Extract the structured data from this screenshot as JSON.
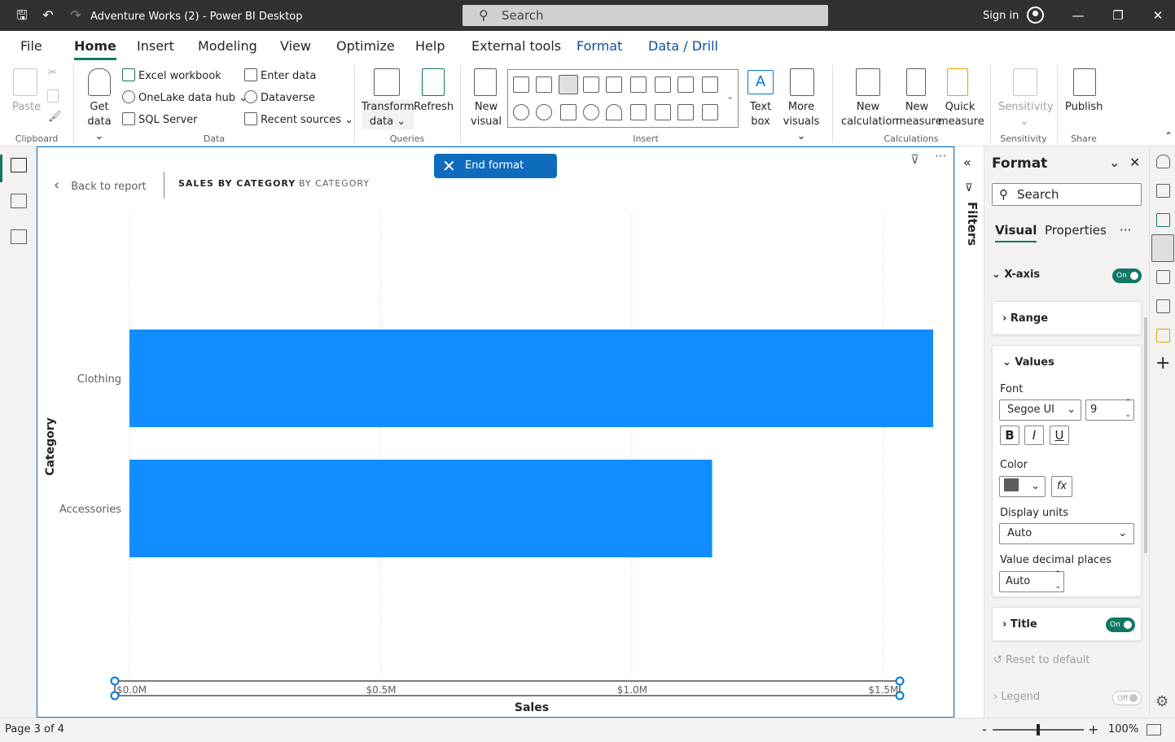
{
  "window": {
    "title": "Adventure Works (2) - Power BI Desktop",
    "search_placeholder": "Search",
    "sign_in": "Sign in"
  },
  "menu_tabs": [
    "File",
    "Home",
    "Insert",
    "Modeling",
    "View",
    "Optimize",
    "Help",
    "External tools",
    "Format",
    "Data / Drill"
  ],
  "ribbon": {
    "clipboard": {
      "paste": "Paste",
      "group": "Clipboard"
    },
    "data": {
      "get_data": "Get",
      "get_data2": "data",
      "excel": "Excel workbook",
      "onelake": "OneLake data hub",
      "sql": "SQL Server",
      "enter_data": "Enter data",
      "dataverse": "Dataverse",
      "recent": "Recent sources",
      "group": "Data"
    },
    "queries": {
      "transform": "Transform",
      "transform2": "data",
      "refresh": "Refresh",
      "group": "Queries"
    },
    "insert": {
      "new_visual": "New",
      "new_visual2": "visual",
      "text_box": "Text",
      "text_box2": "box",
      "more_visuals": "More",
      "more_visuals2": "visuals",
      "group": "Insert"
    },
    "calculations": {
      "new_calc": "New",
      "new_calc2": "calculation",
      "new_measure": "New",
      "new_measure2": "measure",
      "quick": "Quick",
      "quick2": "measure",
      "group": "Calculations"
    },
    "sensitivity": {
      "label": "Sensitivity",
      "group": "Sensitivity"
    },
    "share": {
      "publish": "Publish",
      "group": "Share"
    }
  },
  "canvas": {
    "back": "Back to report",
    "crumb1": "SALES BY CATEGORY",
    "crumb2": "BY CATEGORY",
    "end_format": "End format mode"
  },
  "chart_data": {
    "type": "bar",
    "orientation": "horizontal",
    "categories": [
      "Clothing",
      "Accessories"
    ],
    "values": [
      1.6,
      1.16
    ],
    "xlabel": "Sales",
    "ylabel": "Category",
    "xlim": [
      0,
      1.6
    ],
    "x_ticks": [
      "$0.0M",
      "$0.5M",
      "$1.0M",
      "$1.5M"
    ],
    "x_tick_values": [
      0,
      0.5,
      1.0,
      1.5
    ],
    "bar_color": "#118dff",
    "grid": true
  },
  "filters_pane": {
    "label": "Filters"
  },
  "format_pane": {
    "title": "Format",
    "search_placeholder": "Search",
    "tabs": [
      "Visual",
      "Properties"
    ],
    "xaxis": "X-axis",
    "on": "On",
    "off": "Off",
    "range": "Range",
    "values": "Values",
    "font_label": "Font",
    "font_value": "Segoe UI",
    "font_size": "9",
    "bold": "B",
    "italic": "I",
    "underline": "U",
    "color_label": "Color",
    "color_value": "#605e5c",
    "fx": "fx",
    "display_units_label": "Display units",
    "display_units_value": "Auto",
    "decimal_label": "Value decimal places",
    "decimal_value": "Auto",
    "title_section": "Title",
    "reset": "Reset to default",
    "legend": "Legend"
  },
  "status": {
    "page": "Page 3 of 4",
    "zoom": "100%"
  }
}
